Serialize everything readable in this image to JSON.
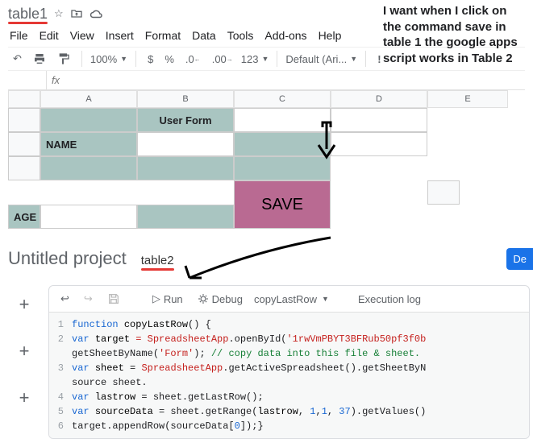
{
  "doc_title": "table1",
  "menus": [
    "File",
    "Edit",
    "View",
    "Insert",
    "Format",
    "Data",
    "Tools",
    "Add-ons",
    "Help"
  ],
  "toolbar": {
    "zoom": "100%",
    "currency": "$",
    "percent": "%",
    "dec_dec": ".0",
    "dec_inc": ".00",
    "fmt": "123",
    "font": "Default (Ari...",
    "undo_icon": "↶",
    "print_icon": "🖶",
    "paint_icon": "⬚"
  },
  "fx_label": "fx",
  "columns": [
    "A",
    "B",
    "C",
    "D",
    "E"
  ],
  "form": {
    "title": "User Form",
    "name_label": "NAME",
    "age_label": "AGE",
    "name_value": "",
    "age_value": ""
  },
  "save_label": "SAVE",
  "script": {
    "project_title": "Untitled project",
    "tab": "table2",
    "deploy": "De",
    "run": "Run",
    "debug": "Debug",
    "func": "copyLastRow",
    "exec_log": "Execution log",
    "plus": "+"
  },
  "code": {
    "l1_kw": "function",
    "l1_name": "copyLastRow",
    "l1_rest": "() {",
    "l2_kw": "var",
    "l2_v": "target",
    "l2_op": "=",
    "l2_cls": "SpreadsheetApp",
    "l2_m": ".openById(",
    "l2_str": "'1rwVmPBYT3BFRub50pf3f0b",
    "l2b_m": "getSheetByName(",
    "l2b_str": "'Form'",
    "l2b_close": ");",
    "l2b_cmt": "// copy data into this file & sheet.",
    "l3_kw": "var",
    "l3_v": "sheet",
    "l3_eq": " = ",
    "l3_cls": "SpreadsheetApp",
    "l3_rest": ".getActiveSpreadsheet().getSheetByN",
    "l3b": "source sheet.",
    "l4_kw": "var",
    "l4_v": "lastrow",
    "l4_rest": " = sheet.getLastRow();",
    "l5_kw": "var",
    "l5_v": "sourceData",
    "l5_a": " = sheet.getRange(",
    "l5_arg": "lastrow",
    "l5_b": ", ",
    "l5_n1": "1",
    "l5_c": ",",
    "l5_n2": "1",
    "l5_d": ", ",
    "l5_n3": "37",
    "l5_e": ").getValues()",
    "l6": "target.appendRow(sourceData[",
    "l6_n": "0",
    "l6_end": "]);}"
  },
  "annotation": "I want when I click on the command save in table 1 the google apps script works in Table 2"
}
